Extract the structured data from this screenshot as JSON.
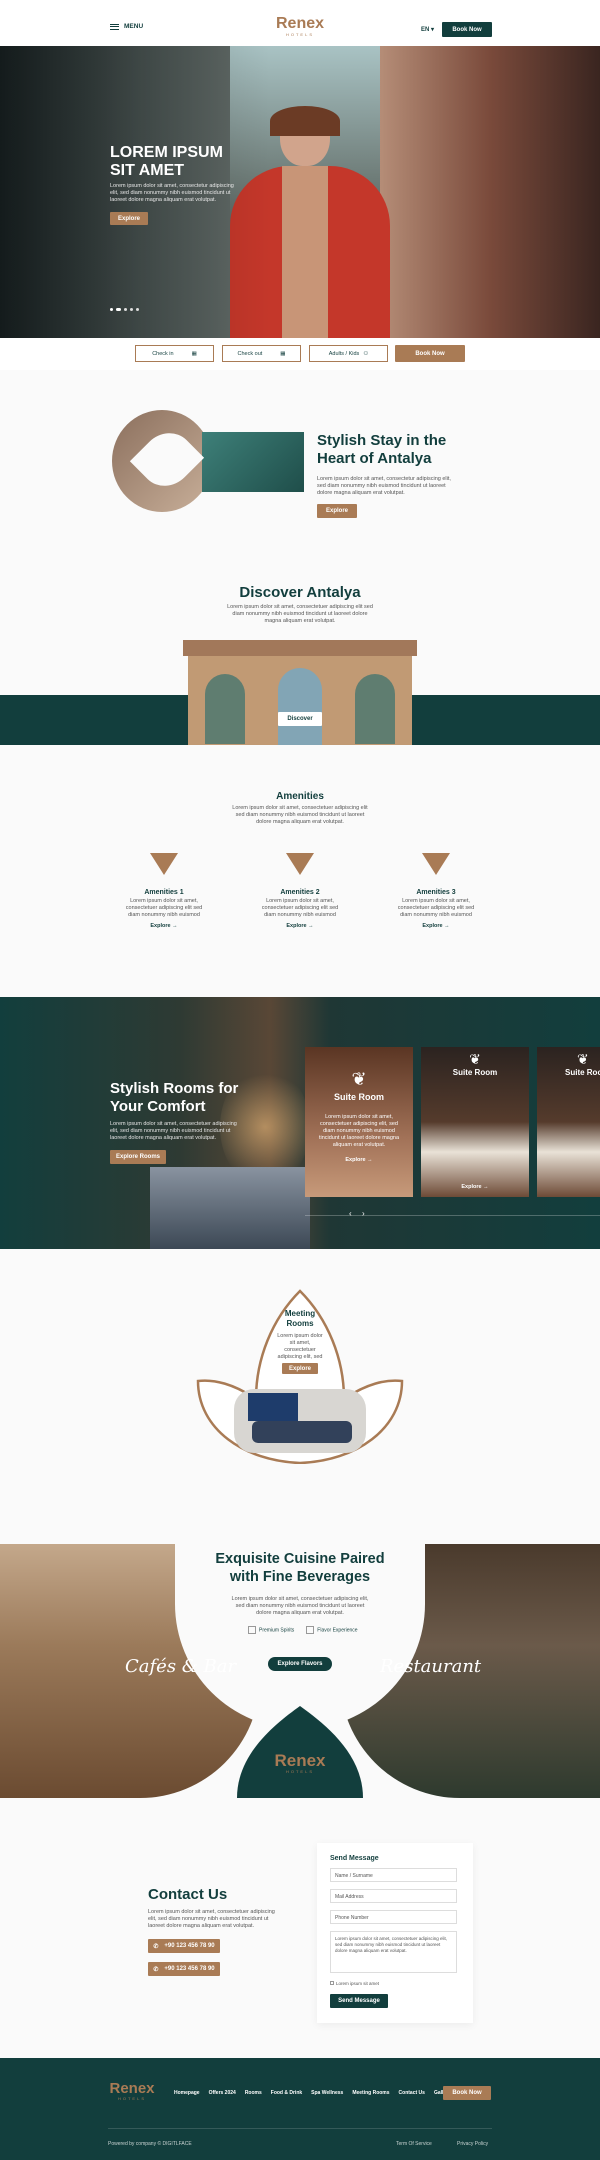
{
  "header": {
    "menu_label": "MENU",
    "logo_name": "Renex",
    "logo_sub": "HOTELS",
    "lang_label": "EN",
    "book_now": "Book Now"
  },
  "hero": {
    "title_line1": "LOREM IPSUM",
    "title_line2": "SIT AMET",
    "text": "Lorem ipsum dolor sit amet, consectetur adipiscing elit, sed diam nonummy nibh euismod tincidunt ut laoreet dolore magna aliquam erat volutpat.",
    "explore": "Explore",
    "slides": 5,
    "active_slide": 2
  },
  "booking": {
    "check_in": "Check in",
    "check_out": "Check out",
    "guests": "Adults / Kids",
    "book_now": "Book Now"
  },
  "stylish_stay": {
    "title_line1": "Stylish Stay in the",
    "title_line2": "Heart of Antalya",
    "text": "Lorem ipsum dolor sit amet, consectetur adipiscing elit, sed diam nonummy nibh euismod tincidunt ut laoreet dolore magna aliquam erat volutpat.",
    "explore": "Explore"
  },
  "discover": {
    "title": "Discover Antalya",
    "text": "Lorem ipsum dolor sit amet, consectetuer adipiscing elit sed diam nonummy nibh euismod tincidunt ut laoreet dolore magna aliquam erat volutpat.",
    "button": "Discover"
  },
  "amenities": {
    "title": "Amenities",
    "text": "Lorem ipsum dolor sit amet, consectetuer adipiscing elit sed diam nonummy nibh euismod tincidunt ut laoreet dolore magna aliquam erat volutpat.",
    "items": [
      {
        "title": "Amenities 1",
        "text": "Lorem ipsum dolor sit amet, consectetuer adipiscing elit sed diam nonummy nibh euismod tincidunt ut laoreet dolore magna aliquam erat volutpat.",
        "link": "Explore"
      },
      {
        "title": "Amenities 2",
        "text": "Lorem ipsum dolor sit amet, consectetuer adipiscing elit sed diam nonummy nibh euismod tincidunt ut laoreet dolore magna aliquam erat volutpat.",
        "link": "Explore"
      },
      {
        "title": "Amenities 3",
        "text": "Lorem ipsum dolor sit amet, consectetuer adipiscing elit sed diam nonummy nibh euismod tincidunt ut laoreet dolore magna aliquam erat volutpat.",
        "link": "Explore"
      }
    ]
  },
  "rooms": {
    "title_line1": "Stylish Rooms for",
    "title_line2": "Your Comfort",
    "text": "Lorem ipsum dolor sit amet, consectetuer adipiscing elit, sed diam nonummy nibh euismod tincidunt ut laoreet dolore magna aliquam erat volutpat.",
    "explore": "Explore Rooms",
    "cards": [
      {
        "title": "Suite Room",
        "text": "Lorem ipsum dolor sit amet, consectetuer adipiscing elit, sed diam nonummy nibh euismod tincidunt ut laoreet dolore magna aliquam erat volutpat.",
        "link": "Explore"
      },
      {
        "title": "Suite Room",
        "link": "Explore"
      },
      {
        "title": "Suite Room"
      }
    ]
  },
  "meeting": {
    "title_line1": "Meeting",
    "title_line2": "Rooms",
    "text": "Lorem ipsum dolor sit amet, consectetuer adipiscing elit, sed diam nonummy nibh euismod tincidunt ut laoreet dolore magna aliquam erat volutpat.",
    "explore": "Explore"
  },
  "cuisine": {
    "title_line1": "Exquisite Cuisine Paired",
    "title_line2": "with Fine Beverages",
    "text": "Lorem ipsum dolor sit amet, consectetuer adipiscing elit, sed diam nonummy nibh euismod tincidunt ut laoreet dolore magna aliquam erat volutpat.",
    "feature1": "Premium Spirits",
    "feature2": "Flavor Experience",
    "left_label": "Cafés & Bar",
    "right_label": "Restaurant",
    "explore": "Explore Flavors"
  },
  "contact": {
    "title": "Contact Us",
    "text": "Lorem ipsum dolor sit amet, consectetuer adipiscing elit, sed diam nonummy nibh euismod tincidunt ut laoreet dolore magna aliquam erat volutpat.",
    "phone1": "+90 123 456 78 90",
    "phone2": "+90 123 456 78 90",
    "form_title": "Send Message",
    "name_placeholder": "Name / Surname",
    "mail_placeholder": "Mail Address",
    "phone_placeholder": "Phone Number",
    "message_text": "Lorem ipsum dolor sit amet, consectetuer adipiscing elit, sed diam nonummy nibh euismod tincidunt ut laoreet dolore magna aliquam erat volutpat.",
    "consent": "Lorem ipsum sit amet",
    "send": "Send Message"
  },
  "footer": {
    "logo_name": "Renex",
    "logo_sub": "HOTELS",
    "links": [
      "Homepage",
      "Offers 2024",
      "Rooms",
      "Food & Drink",
      "Spa Wellness",
      "Meeting Rooms",
      "Contact Us",
      "Gallery"
    ],
    "book_now": "Book Now",
    "powered": "Powered by company © DIGITLFACE",
    "terms": "Term Of Service",
    "privacy": "Privacy Policy"
  },
  "colors": {
    "teal": "#123e3d",
    "bronze": "#a97b55"
  }
}
